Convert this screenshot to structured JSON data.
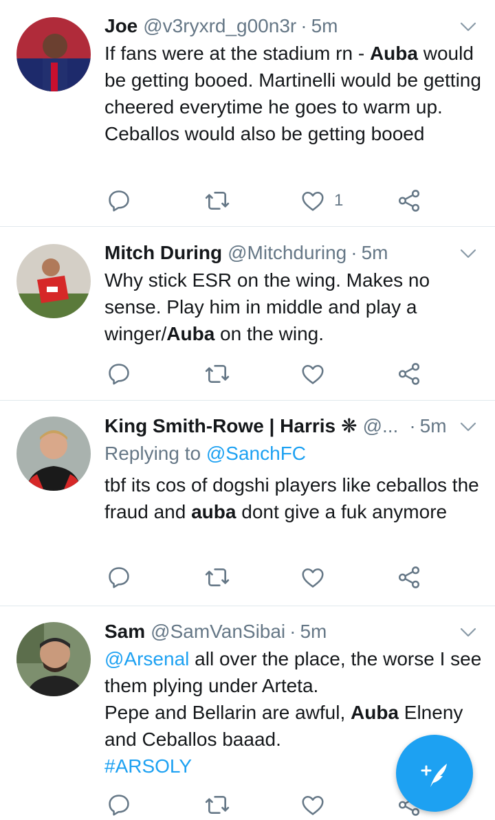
{
  "tweets": [
    {
      "name": "Joe",
      "handle": "@v3ryxrd_g00n3r",
      "dot": "·",
      "time": "5m",
      "body": [
        {
          "t": "If fans were at the stadium rn - "
        },
        {
          "t": "Auba",
          "bold": true
        },
        {
          "t": " would be getting booed. Martinelli would be getting cheered everytime he goes to warm up. Ceballos would also be getting booed"
        }
      ],
      "like_count": "1"
    },
    {
      "name": "Mitch During",
      "handle": "@Mitchduring",
      "dot": "·",
      "time": "5m",
      "body": [
        {
          "t": "Why stick ESR on the wing. Makes no sense. Play him in middle and play a winger/"
        },
        {
          "t": "Auba",
          "bold": true
        },
        {
          "t": " on the wing."
        }
      ],
      "like_count": ""
    },
    {
      "name": "King Smith-Rowe | Harris",
      "badge": "❋",
      "handle": "@...",
      "dot": "·",
      "time": "5m",
      "reply_prefix": "Replying to ",
      "reply_to": "@SanchFC",
      "body": [
        {
          "t": "tbf its cos of dogshi players like ceballos the fraud and "
        },
        {
          "t": "auba",
          "bold": true
        },
        {
          "t": " dont give a fuk anymore"
        }
      ],
      "like_count": ""
    },
    {
      "name": "Sam",
      "handle": "@SamVanSibai",
      "dot": "·",
      "time": "5m",
      "body": [
        {
          "t": "@Arsenal",
          "link": true
        },
        {
          "t": " all over the place, the worse I see them plying under Arteta."
        },
        {
          "br": true
        },
        {
          "t": "Pepe and Bellarin are awful, "
        },
        {
          "t": "Auba",
          "bold": true
        },
        {
          "t": " Elneny and Ceballos baaad."
        },
        {
          "br": true
        },
        {
          "t": "#ARSOLY",
          "link": true
        }
      ],
      "like_count": ""
    }
  ],
  "icons": [
    "reply-icon",
    "retweet-icon",
    "like-icon",
    "share-icon",
    "caret-down-icon",
    "compose-icon"
  ],
  "colors": {
    "text": "#14171a",
    "secondary": "#657786",
    "link": "#1da1f2",
    "fab": "#1da1f2",
    "divider": "#e1e8ed"
  }
}
